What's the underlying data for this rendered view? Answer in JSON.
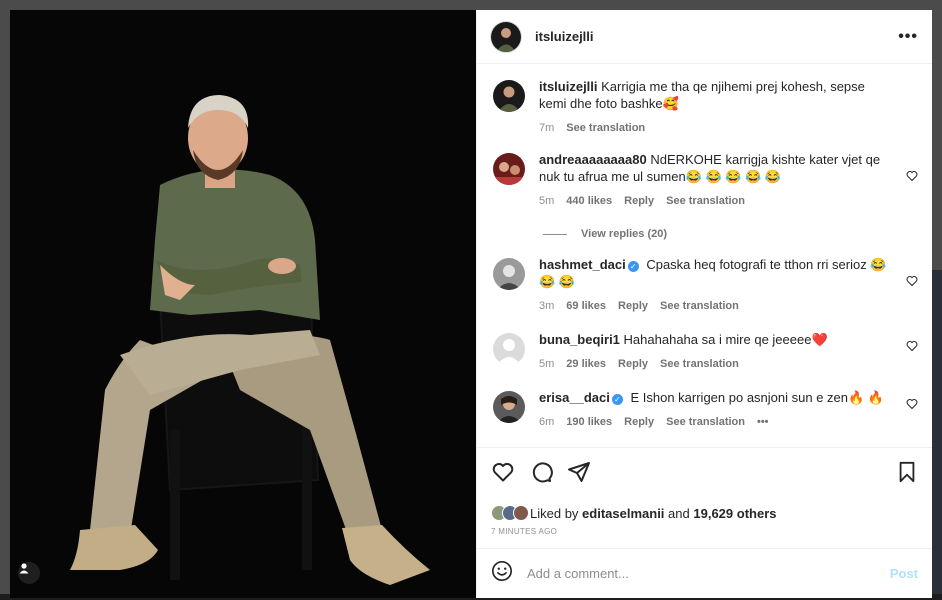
{
  "post": {
    "author": "itsluizejlli",
    "caption": {
      "username": "itsluizejlli",
      "text": "Karrigia me tha qe njihemi prej kohesh, sepse kemi dhe foto bashke🥰",
      "time": "7m",
      "see_translation": "See translation"
    }
  },
  "comments": [
    {
      "username": "andreaaaaaaaa80",
      "verified": false,
      "text": "NdERKOHE karrigja kishte kater vjet qe nuk tu afrua me ul sumen😂 😂 😂 😂 😂",
      "time": "5m",
      "likes": "440 likes",
      "reply": "Reply",
      "see_translation": "See translation",
      "view_replies": "View replies (20)"
    },
    {
      "username": "hashmet_daci",
      "verified": true,
      "text": "Cpaska heq fotografi te tthon rri serioz 😂 😂 😂",
      "time": "3m",
      "likes": "69 likes",
      "reply": "Reply",
      "see_translation": "See translation"
    },
    {
      "username": "buna_beqiri1",
      "verified": false,
      "text": "Hahahahaha sa i mire qe jeeeee❤️",
      "time": "5m",
      "likes": "29 likes",
      "reply": "Reply",
      "see_translation": "See translation"
    },
    {
      "username": "erisa__daci",
      "verified": true,
      "text": "E Ishon karrigen po asnjoni sun e zen🔥 🔥",
      "time": "6m",
      "likes": "190 likes",
      "reply": "Reply",
      "see_translation": "See translation",
      "more": "•••"
    }
  ],
  "likes_summary": {
    "prefix": "Liked by",
    "user": "editaselmanii",
    "connector": "and",
    "others": "19,629 others"
  },
  "timestamp": "7 MINUTES AGO",
  "add_comment": {
    "placeholder": "Add a comment...",
    "post_label": "Post"
  },
  "icons": {
    "more": "more-options-icon",
    "like": "heart-icon",
    "comment": "comment-icon",
    "share": "share-icon",
    "save": "bookmark-icon",
    "emoji": "emoji-icon",
    "tag": "user-tag-icon"
  },
  "colors": {
    "link": "#8e8e8e",
    "verified": "#3897f0",
    "post_disabled": "#b2dffc",
    "like_heart": "#ed4956"
  }
}
